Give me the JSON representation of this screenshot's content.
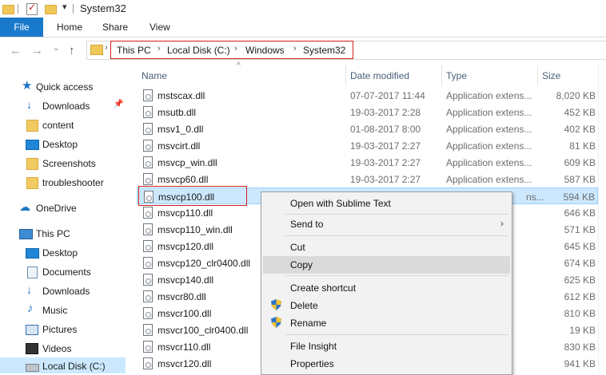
{
  "window": {
    "title": "System32"
  },
  "ribbon": {
    "tabs": [
      "File",
      "Home",
      "Share",
      "View"
    ]
  },
  "address": {
    "crumbs": [
      "This PC",
      "Local Disk (C:)",
      "Windows",
      "System32"
    ]
  },
  "nav": [
    {
      "label": "Quick access",
      "icon": "star-icon",
      "pinned": false
    },
    {
      "label": "Downloads",
      "icon": "download-arrow-icon",
      "pinned": true
    },
    {
      "label": "content",
      "icon": "folder-icon",
      "pinned": false
    },
    {
      "label": "Desktop",
      "icon": "desktop-icon",
      "pinned": false
    },
    {
      "label": "Screenshots",
      "icon": "folder-icon",
      "pinned": false
    },
    {
      "label": "troubleshooter",
      "icon": "folder-icon",
      "pinned": false
    },
    {
      "label": "OneDrive",
      "icon": "cloud-icon",
      "pinned": false
    },
    {
      "label": "This PC",
      "icon": "computer-icon",
      "pinned": false
    },
    {
      "label": "Desktop",
      "icon": "desktop-icon",
      "pinned": false
    },
    {
      "label": "Documents",
      "icon": "documents-icon",
      "pinned": false
    },
    {
      "label": "Downloads",
      "icon": "download-arrow-icon",
      "pinned": false
    },
    {
      "label": "Music",
      "icon": "music-note-icon",
      "pinned": false
    },
    {
      "label": "Pictures",
      "icon": "pictures-icon",
      "pinned": false
    },
    {
      "label": "Videos",
      "icon": "video-icon",
      "pinned": false
    },
    {
      "label": "Local Disk (C:)",
      "icon": "drive-icon",
      "pinned": false
    }
  ],
  "columns": {
    "name": "Name",
    "date": "Date modified",
    "type": "Type",
    "size": "Size"
  },
  "files": [
    {
      "name": "mstscax.dll",
      "date": "07-07-2017 11:44",
      "type": "Application extens...",
      "size": "8,020 KB"
    },
    {
      "name": "msutb.dll",
      "date": "19-03-2017 2:28",
      "type": "Application extens...",
      "size": "452 KB"
    },
    {
      "name": "msv1_0.dll",
      "date": "01-08-2017 8:00",
      "type": "Application extens...",
      "size": "402 KB"
    },
    {
      "name": "msvcirt.dll",
      "date": "19-03-2017 2:27",
      "type": "Application extens...",
      "size": "81 KB"
    },
    {
      "name": "msvcp_win.dll",
      "date": "19-03-2017 2:27",
      "type": "Application extens...",
      "size": "609 KB"
    },
    {
      "name": "msvcp60.dll",
      "date": "19-03-2017 2:27",
      "type": "Application extens...",
      "size": "587 KB"
    },
    {
      "name": "msvcp100.dll",
      "date": "",
      "type": "ns...",
      "size": "594 KB"
    },
    {
      "name": "msvcp110.dll",
      "date": "",
      "type": "ns...",
      "size": "646 KB"
    },
    {
      "name": "msvcp110_win.dll",
      "date": "",
      "type": "ns...",
      "size": "571 KB"
    },
    {
      "name": "msvcp120.dll",
      "date": "",
      "type": "ns...",
      "size": "645 KB"
    },
    {
      "name": "msvcp120_clr0400.dll",
      "date": "",
      "type": "ns...",
      "size": "674 KB"
    },
    {
      "name": "msvcp140.dll",
      "date": "",
      "type": "ns...",
      "size": "625 KB"
    },
    {
      "name": "msvcr80.dll",
      "date": "",
      "type": "ns...",
      "size": "612 KB"
    },
    {
      "name": "msvcr100.dll",
      "date": "",
      "type": "ns...",
      "size": "810 KB"
    },
    {
      "name": "msvcr100_clr0400.dll",
      "date": "",
      "type": "ns...",
      "size": "19 KB"
    },
    {
      "name": "msvcr110.dll",
      "date": "",
      "type": "ns...",
      "size": "830 KB"
    },
    {
      "name": "msvcr120.dll",
      "date": "",
      "type": "ns...",
      "size": "941 KB"
    }
  ],
  "context_menu": {
    "open_with": "Open with Sublime Text",
    "send_to": "Send to",
    "cut": "Cut",
    "copy": "Copy",
    "create_shortcut": "Create shortcut",
    "delete": "Delete",
    "rename": "Rename",
    "file_insight": "File Insight",
    "properties": "Properties"
  }
}
